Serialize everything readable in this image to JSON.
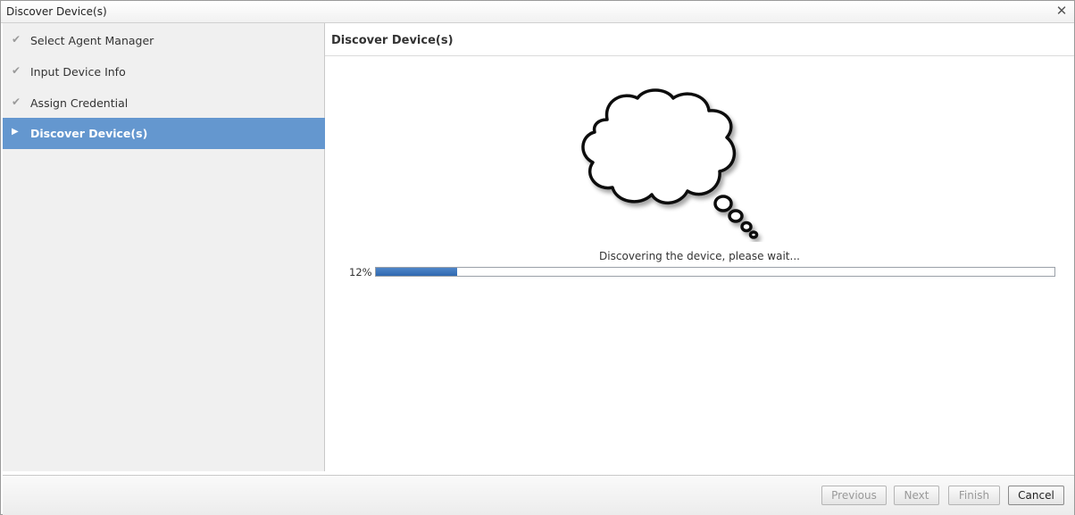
{
  "window": {
    "title": "Discover Device(s)",
    "close_icon": "close-icon"
  },
  "sidebar": {
    "steps": [
      {
        "label": "Select Agent Manager",
        "status": "done",
        "icon": "checkmark-icon"
      },
      {
        "label": "Input Device Info",
        "status": "done",
        "icon": "checkmark-icon"
      },
      {
        "label": "Assign Credential",
        "status": "done",
        "icon": "checkmark-icon"
      },
      {
        "label": "Discover Device(s)",
        "status": "active",
        "icon": "play-arrow-icon"
      }
    ],
    "active_color": "#6497cf"
  },
  "main": {
    "title": "Discover Device(s)",
    "illustration": "thought-cloud-icon",
    "status_text": "Discovering the device, please wait...",
    "progress": {
      "label": "12%",
      "value": 0.12,
      "color": "#3a74bc"
    }
  },
  "footer": {
    "previous_label": "Previous",
    "next_label": "Next",
    "finish_label": "Finish",
    "cancel_label": "Cancel"
  }
}
